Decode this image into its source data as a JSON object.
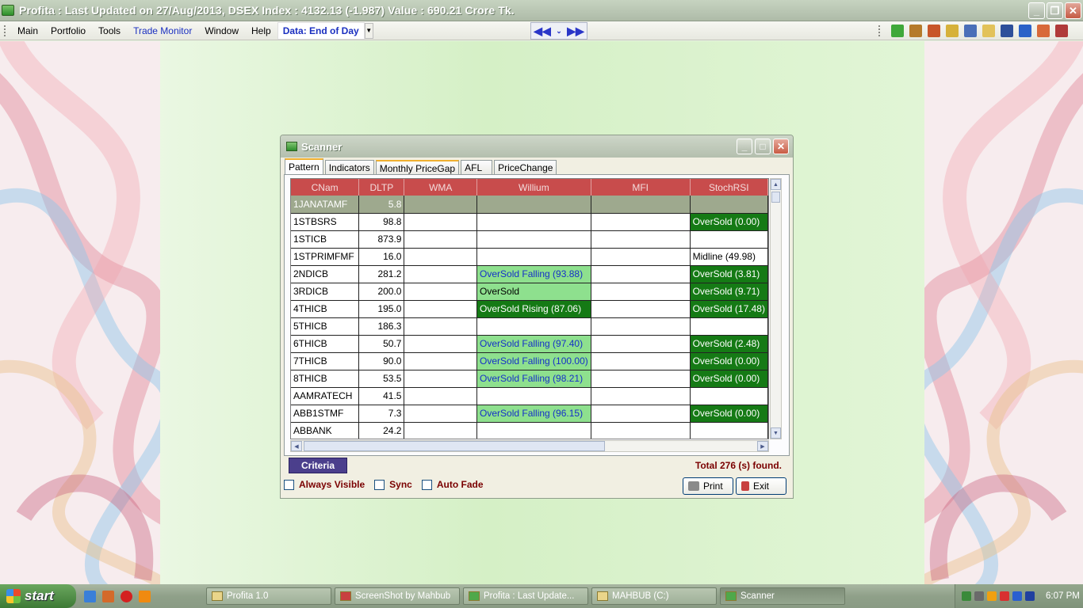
{
  "titlebar": {
    "title": "Profita : Last Updated on 27/Aug/2013,  DSEX Index : 4132.13 (-1.987)  Value : 690.21 Crore Tk."
  },
  "menubar": {
    "items": [
      "Main",
      "Portfolio",
      "Tools",
      "Trade Monitor",
      "Window",
      "Help"
    ],
    "data_selector": "Data: End of Day"
  },
  "scanner": {
    "title": "Scanner",
    "tabs": [
      "Pattern",
      "Indicators",
      "Monthly PriceGap",
      "AFL",
      "PriceChange"
    ],
    "active_tab": "Pattern",
    "columns": [
      "CNam",
      "DLTP",
      "WMA",
      "Willium",
      "MFI",
      "StochRSI"
    ],
    "rows": [
      {
        "cnam": "1JANATAMF",
        "dltp": "5.8",
        "wma": "",
        "willium": "",
        "mfi": "",
        "stochrsi": ""
      },
      {
        "cnam": "1STBSRS",
        "dltp": "98.8",
        "wma": "",
        "willium": "",
        "mfi": "",
        "stochrsi": "OverSold (0.00)"
      },
      {
        "cnam": "1STICB",
        "dltp": "873.9",
        "wma": "",
        "willium": "",
        "mfi": "",
        "stochrsi": ""
      },
      {
        "cnam": "1STPRIMFMF",
        "dltp": "16.0",
        "wma": "",
        "willium": "",
        "mfi": "",
        "stochrsi": "Midline (49.98)"
      },
      {
        "cnam": "2NDICB",
        "dltp": "281.2",
        "wma": "",
        "willium": "OverSold Falling (93.88)",
        "mfi": "",
        "stochrsi": "OverSold (3.81)"
      },
      {
        "cnam": "3RDICB",
        "dltp": "200.0",
        "wma": "",
        "willium": "OverSold",
        "mfi": "",
        "stochrsi": "OverSold (9.71)"
      },
      {
        "cnam": "4THICB",
        "dltp": "195.0",
        "wma": "",
        "willium": "OverSold Rising (87.06)",
        "mfi": "",
        "stochrsi": "OverSold (17.48)"
      },
      {
        "cnam": "5THICB",
        "dltp": "186.3",
        "wma": "",
        "willium": "",
        "mfi": "",
        "stochrsi": ""
      },
      {
        "cnam": "6THICB",
        "dltp": "50.7",
        "wma": "",
        "willium": "OverSold Falling (97.40)",
        "mfi": "",
        "stochrsi": "OverSold (2.48)"
      },
      {
        "cnam": "7THICB",
        "dltp": "90.0",
        "wma": "",
        "willium": "OverSold Falling (100.00)",
        "mfi": "",
        "stochrsi": "OverSold (0.00)"
      },
      {
        "cnam": "8THICB",
        "dltp": "53.5",
        "wma": "",
        "willium": "OverSold Falling (98.21)",
        "mfi": "",
        "stochrsi": "OverSold (0.00)"
      },
      {
        "cnam": "AAMRATECH",
        "dltp": "41.5",
        "wma": "",
        "willium": "",
        "mfi": "",
        "stochrsi": ""
      },
      {
        "cnam": "ABB1STMF",
        "dltp": "7.3",
        "wma": "",
        "willium": "OverSold Falling (96.15)",
        "mfi": "",
        "stochrsi": "OverSold (0.00)"
      },
      {
        "cnam": "ABBANK",
        "dltp": "24.2",
        "wma": "",
        "willium": "",
        "mfi": "",
        "stochrsi": ""
      }
    ],
    "criteria_label": "Criteria",
    "found_text": "Total 276 (s) found.",
    "checkboxes": [
      "Always Visible",
      "Sync",
      "Auto Fade"
    ],
    "print_label": "Print",
    "exit_label": "Exit"
  },
  "taskbar": {
    "start_label": "start",
    "tasks": [
      "Profita 1.0",
      "ScreenShot by Mahbub",
      "Profita : Last Update...",
      "MAHBUB (C:)",
      "Scanner"
    ],
    "active_task": "Scanner",
    "clock": "6:07 PM"
  },
  "colors": {
    "header_red": "#c84c4c",
    "oversold_dark": "#157a15",
    "oversold_light": "#8ee08e",
    "criteria_purple": "#4b3f8c"
  }
}
